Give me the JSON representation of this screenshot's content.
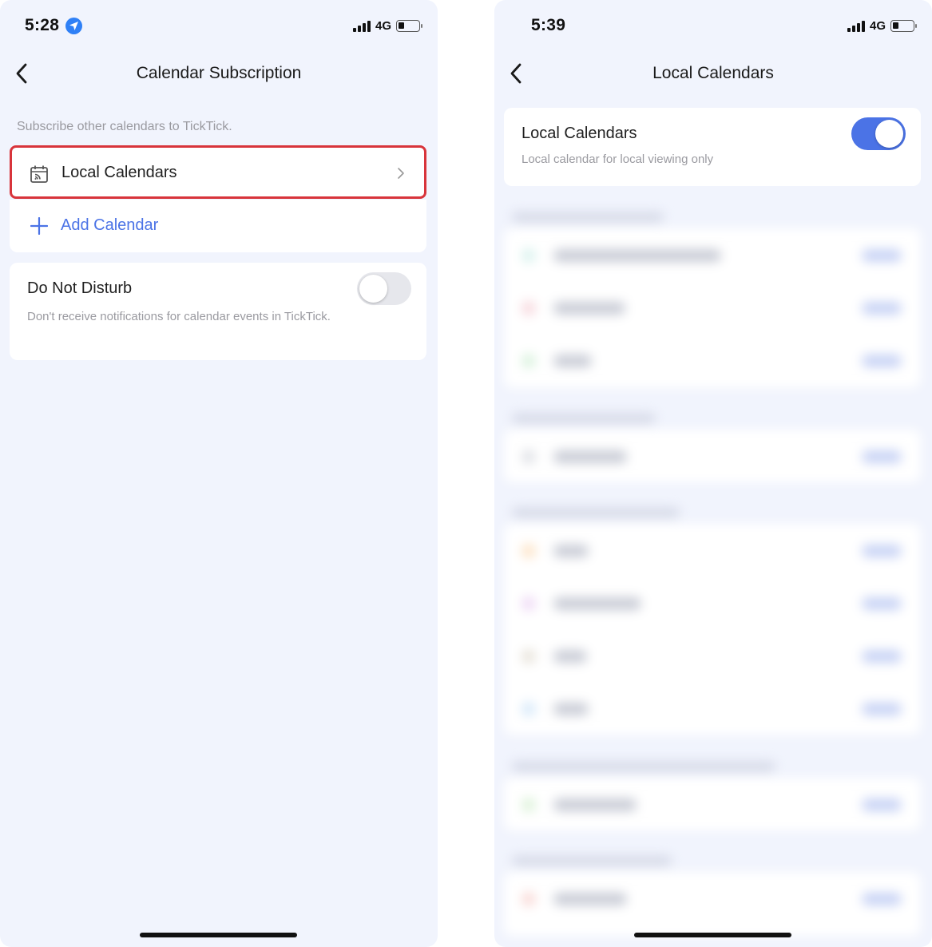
{
  "left_screen": {
    "status": {
      "time": "5:28",
      "network": "4G"
    },
    "nav": {
      "title": "Calendar Subscription"
    },
    "hint": "Subscribe other calendars to TickTick.",
    "local_calendars_row": {
      "label": "Local Calendars"
    },
    "add_calendar": {
      "label": "Add Calendar"
    },
    "do_not_disturb": {
      "title": "Do Not Disturb",
      "description": "Don't receive notifications for calendar events in TickTick.",
      "enabled": false
    }
  },
  "right_screen": {
    "status": {
      "time": "5:39",
      "network": "4G"
    },
    "nav": {
      "title": "Local Calendars"
    },
    "local_calendars": {
      "title": "Local Calendars",
      "description": "Local calendar for local viewing only",
      "enabled": true
    }
  },
  "colors": {
    "accent": "#4b73e6",
    "highlight_border": "#d8343b",
    "background": "#f1f4fd"
  }
}
